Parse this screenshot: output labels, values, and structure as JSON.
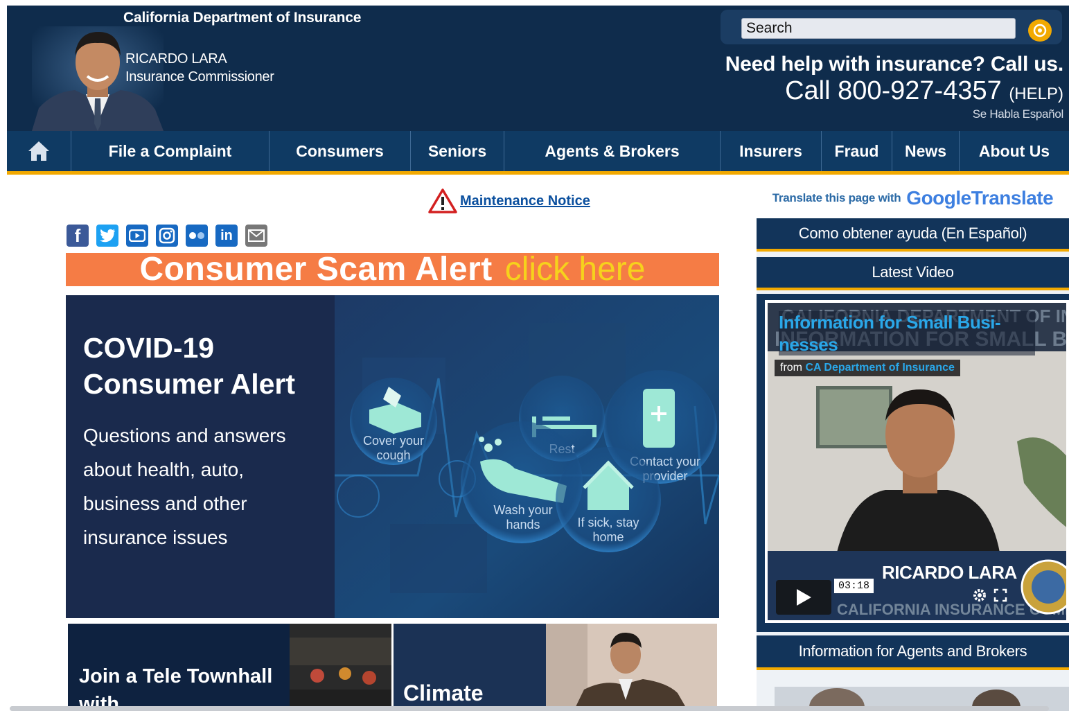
{
  "header": {
    "dept_name": "California Department of Insurance",
    "commissioner_name": "RICARDO LARA",
    "commissioner_title": "Insurance Commissioner",
    "search_placeholder": "Search",
    "help_line": "Need help with insurance? Call us.",
    "phone_prefix": "Call 800-927-4357",
    "phone_suffix": "(HELP)",
    "spanish": "Se Habla Español"
  },
  "nav": {
    "items": [
      "File a Complaint",
      "Consumers",
      "Seniors",
      "Agents & Brokers",
      "Insurers",
      "Fraud",
      "News",
      "About Us"
    ]
  },
  "maintenance": {
    "label": "Maintenance Notice"
  },
  "social": {
    "icons": [
      "facebook-icon",
      "twitter-icon",
      "youtube-icon",
      "instagram-icon",
      "flickr-icon",
      "linkedin-icon",
      "email-icon"
    ]
  },
  "scam_banner": {
    "title": "Consumer Scam Alert",
    "action": "click here"
  },
  "covid": {
    "title": "COVID-19 Consumer Alert",
    "body": "Questions and answers about health, auto, business and other insurance issues",
    "tips": [
      "Cover your cough",
      "Rest",
      "Contact your provider",
      "Wash your hands",
      "If sick, stay home"
    ]
  },
  "tiles": {
    "townhall": "Join a Tele Townhall with",
    "climate": "Climate"
  },
  "sidebar": {
    "translate_label": "Translate this page with",
    "google": "Google",
    "translate_word": "Translate",
    "spanish_help": "Como obtener ayuda (En Español)",
    "latest_video": "Latest Video",
    "video_title": "Information for Small Busi-nesses",
    "video_from_prefix": "from",
    "video_from_source": "CA Department of Insurance",
    "video_caption": "RICARDO LARA",
    "video_duration": "03:18",
    "agents_info": "Information for Agents and Brokers"
  },
  "colors": {
    "header_bg": "#0f2c4c",
    "nav_bg": "#0f3a63",
    "accent_gold": "#f2a900",
    "scam_orange": "#f57c45",
    "link_blue": "#0a4f9e"
  }
}
